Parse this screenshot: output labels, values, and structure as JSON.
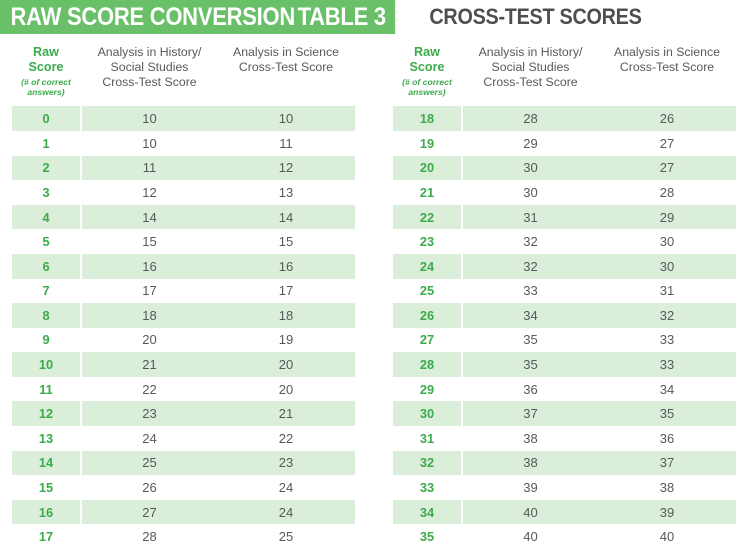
{
  "header": {
    "banner_title": "RAW SCORE CONVERSION",
    "banner_table_label": "TABLE 3",
    "subtitle": "CROSS-TEST SCORES",
    "banner_color": "#6abf69",
    "subtitle_color": "#4d4e50"
  },
  "columns": {
    "raw_score": "Raw Score",
    "raw_score_note": "(# of correct answers)",
    "history": "Analysis in History/ Social Studies Cross-Test Score",
    "history_lines": [
      "Analysis in History/",
      "Social Studies",
      "Cross-Test Score"
    ],
    "science": "Analysis in Science Cross-Test Score",
    "science_lines": [
      "Analysis in Science",
      "Cross-Test Score"
    ]
  },
  "colors": {
    "accent_green": "#3bab4b",
    "banner_green": "#6abf69",
    "row_stripe": "#daeeda",
    "text_gray": "#58595b"
  },
  "chart_data": {
    "type": "table",
    "title": "Raw Score Conversion Table 3 — Cross-Test Scores",
    "columns": [
      "Raw Score (# of correct answers)",
      "Analysis in History/Social Studies Cross-Test Score",
      "Analysis in Science Cross-Test Score"
    ],
    "rows": [
      [
        0,
        10,
        10
      ],
      [
        1,
        10,
        11
      ],
      [
        2,
        11,
        12
      ],
      [
        3,
        12,
        13
      ],
      [
        4,
        14,
        14
      ],
      [
        5,
        15,
        15
      ],
      [
        6,
        16,
        16
      ],
      [
        7,
        17,
        17
      ],
      [
        8,
        18,
        18
      ],
      [
        9,
        20,
        19
      ],
      [
        10,
        21,
        20
      ],
      [
        11,
        22,
        20
      ],
      [
        12,
        23,
        21
      ],
      [
        13,
        24,
        22
      ],
      [
        14,
        25,
        23
      ],
      [
        15,
        26,
        24
      ],
      [
        16,
        27,
        24
      ],
      [
        17,
        28,
        25
      ],
      [
        18,
        28,
        26
      ],
      [
        19,
        29,
        27
      ],
      [
        20,
        30,
        27
      ],
      [
        21,
        30,
        28
      ],
      [
        22,
        31,
        29
      ],
      [
        23,
        32,
        30
      ],
      [
        24,
        32,
        30
      ],
      [
        25,
        33,
        31
      ],
      [
        26,
        34,
        32
      ],
      [
        27,
        35,
        33
      ],
      [
        28,
        35,
        33
      ],
      [
        29,
        36,
        34
      ],
      [
        30,
        37,
        35
      ],
      [
        31,
        38,
        36
      ],
      [
        32,
        38,
        37
      ],
      [
        33,
        39,
        38
      ],
      [
        34,
        40,
        39
      ],
      [
        35,
        40,
        40
      ]
    ]
  },
  "left_table": {
    "rows": [
      {
        "raw": "0",
        "history": "10",
        "science": "10"
      },
      {
        "raw": "1",
        "history": "10",
        "science": "11"
      },
      {
        "raw": "2",
        "history": "11",
        "science": "12"
      },
      {
        "raw": "3",
        "history": "12",
        "science": "13"
      },
      {
        "raw": "4",
        "history": "14",
        "science": "14"
      },
      {
        "raw": "5",
        "history": "15",
        "science": "15"
      },
      {
        "raw": "6",
        "history": "16",
        "science": "16"
      },
      {
        "raw": "7",
        "history": "17",
        "science": "17"
      },
      {
        "raw": "8",
        "history": "18",
        "science": "18"
      },
      {
        "raw": "9",
        "history": "20",
        "science": "19"
      },
      {
        "raw": "10",
        "history": "21",
        "science": "20"
      },
      {
        "raw": "11",
        "history": "22",
        "science": "20"
      },
      {
        "raw": "12",
        "history": "23",
        "science": "21"
      },
      {
        "raw": "13",
        "history": "24",
        "science": "22"
      },
      {
        "raw": "14",
        "history": "25",
        "science": "23"
      },
      {
        "raw": "15",
        "history": "26",
        "science": "24"
      },
      {
        "raw": "16",
        "history": "27",
        "science": "24"
      },
      {
        "raw": "17",
        "history": "28",
        "science": "25"
      }
    ]
  },
  "right_table": {
    "rows": [
      {
        "raw": "18",
        "history": "28",
        "science": "26"
      },
      {
        "raw": "19",
        "history": "29",
        "science": "27"
      },
      {
        "raw": "20",
        "history": "30",
        "science": "27"
      },
      {
        "raw": "21",
        "history": "30",
        "science": "28"
      },
      {
        "raw": "22",
        "history": "31",
        "science": "29"
      },
      {
        "raw": "23",
        "history": "32",
        "science": "30"
      },
      {
        "raw": "24",
        "history": "32",
        "science": "30"
      },
      {
        "raw": "25",
        "history": "33",
        "science": "31"
      },
      {
        "raw": "26",
        "history": "34",
        "science": "32"
      },
      {
        "raw": "27",
        "history": "35",
        "science": "33"
      },
      {
        "raw": "28",
        "history": "35",
        "science": "33"
      },
      {
        "raw": "29",
        "history": "36",
        "science": "34"
      },
      {
        "raw": "30",
        "history": "37",
        "science": "35"
      },
      {
        "raw": "31",
        "history": "38",
        "science": "36"
      },
      {
        "raw": "32",
        "history": "38",
        "science": "37"
      },
      {
        "raw": "33",
        "history": "39",
        "science": "38"
      },
      {
        "raw": "34",
        "history": "40",
        "science": "39"
      },
      {
        "raw": "35",
        "history": "40",
        "science": "40"
      }
    ]
  }
}
